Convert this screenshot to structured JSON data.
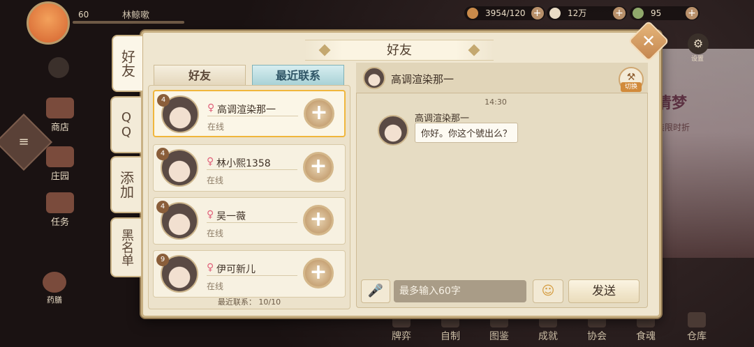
{
  "hud": {
    "level": "60",
    "player_name": "林鲸嗽",
    "stamina": "3954/120",
    "coins": "12万",
    "gems": "95",
    "settings_label": "设置"
  },
  "side_menu": [
    {
      "label": "商店"
    },
    {
      "label": "庄园"
    },
    {
      "label": "任务"
    },
    {
      "label": "药膳"
    }
  ],
  "bottom_menu": [
    {
      "label": "牌弈"
    },
    {
      "label": "自制"
    },
    {
      "label": "图鉴"
    },
    {
      "label": "成就"
    },
    {
      "label": "协会"
    },
    {
      "label": "食魂"
    },
    {
      "label": "仓库"
    }
  ],
  "background": {
    "banner_text": "清梦",
    "banner_sub": "装限时折"
  },
  "dialog": {
    "title": "好友",
    "close": "✕",
    "side_tabs": [
      "好友",
      "QQ",
      "添加",
      "黑名单"
    ],
    "sub_tabs": [
      "好友",
      "最近联系"
    ],
    "friends": [
      {
        "level": "4",
        "gender": "♀",
        "name": "高调渲染那一",
        "status": "在线"
      },
      {
        "level": "4",
        "gender": "♀",
        "name": "林小熙1358",
        "status": "在线"
      },
      {
        "level": "4",
        "gender": "♀",
        "name": "吴一薇",
        "status": "在线"
      },
      {
        "level": "9",
        "gender": "♀",
        "name": "伊可新儿",
        "status": "在线"
      }
    ],
    "recent_count": "最近联系： 10/10",
    "chat": {
      "partner_name": "高调渲染那一",
      "switch_label": "切换",
      "time": "14:30",
      "message_sender": "高调渲染那一",
      "message_text": "你好。你这个號出么？",
      "input_placeholder": "最多输入60字",
      "send_label": "发送"
    }
  },
  "colors": {
    "panel": "#efe6d0",
    "border": "#c9b184",
    "selected_border": "#f0b63c",
    "active_tab": "#a9d2d6",
    "gender_female": "#e0607a"
  }
}
